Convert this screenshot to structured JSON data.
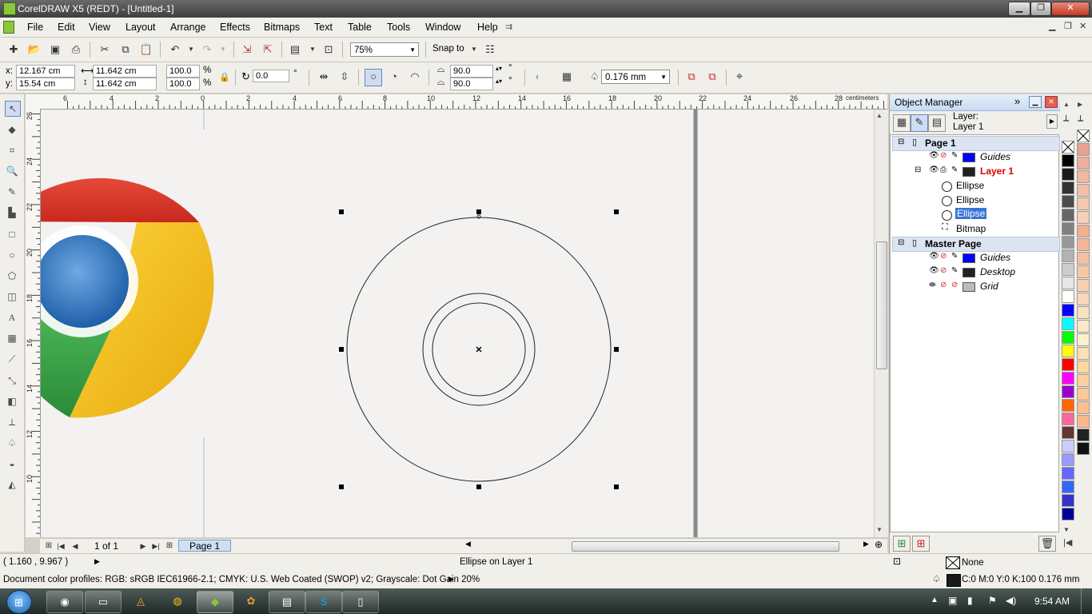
{
  "title": "CorelDRAW X5 (REDT) - [Untitled-1]",
  "window_buttons": {
    "minimize": "▁",
    "restore": "❐",
    "close": "✕"
  },
  "menu": [
    "File",
    "Edit",
    "View",
    "Layout",
    "Arrange",
    "Effects",
    "Bitmaps",
    "Text",
    "Table",
    "Tools",
    "Window",
    "Help"
  ],
  "toolbar": {
    "zoom": "75%",
    "snap_to": "Snap to"
  },
  "propbar": {
    "x": "12.167 cm",
    "y": "15.54 cm",
    "w": "11.642 cm",
    "h": "11.642 cm",
    "scale_x": "100.0",
    "scale_y": "100.0",
    "pct": "%",
    "rotation": "0.0",
    "degree": "°",
    "start_angle": "90.0",
    "end_angle": "90.0",
    "outline": "0.176 mm"
  },
  "ruler": {
    "h_labels": [
      "6",
      "4",
      "2",
      "0",
      "2",
      "4",
      "6",
      "8",
      "10",
      "12",
      "14",
      "16",
      "18",
      "20",
      "22",
      "24",
      "26",
      "28"
    ],
    "unit": "centimeters",
    "v_labels": [
      "26",
      "24",
      "22",
      "20",
      "18",
      "16",
      "14",
      "12",
      "10"
    ]
  },
  "pager": {
    "position": "1 of 1",
    "tab": "Page 1"
  },
  "docker": {
    "title": "Object Manager",
    "layer_label": "Layer:",
    "layer_name": "Layer 1",
    "rows": [
      {
        "kind": "page",
        "label": "Page 1"
      },
      {
        "kind": "layer",
        "label": "Guides",
        "color": "#0000ff"
      },
      {
        "kind": "layer",
        "label": "Layer 1",
        "color": "#222222",
        "active": true
      },
      {
        "kind": "object",
        "label": "Ellipse"
      },
      {
        "kind": "object",
        "label": "Ellipse"
      },
      {
        "kind": "object",
        "label": "Ellipse",
        "selected": true
      },
      {
        "kind": "object",
        "label": "Bitmap"
      },
      {
        "kind": "page",
        "label": "Master Page"
      },
      {
        "kind": "layer",
        "label": "Guides",
        "color": "#0000ff"
      },
      {
        "kind": "layer",
        "label": "Desktop",
        "color": "#222222"
      },
      {
        "kind": "layer",
        "label": "Grid",
        "color": "#bbbbbb"
      }
    ]
  },
  "palette": {
    "col1": [
      "#ffffff",
      "#000000",
      "#1a1a1a",
      "#333333",
      "#4d4d4d",
      "#666666",
      "#808080",
      "#999999",
      "#b3b3b3",
      "#cccccc",
      "#e6e6e6",
      "#ffffff",
      "#0000ff",
      "#00ffff",
      "#00ff00",
      "#ffff00",
      "#ff0000",
      "#ff00ff",
      "#9900cc",
      "#ff6600",
      "#ff6699",
      "#663333",
      "#ccccff",
      "#9999ff",
      "#6666ff",
      "#3366ff",
      "#3333cc",
      "#000099"
    ],
    "col2": [
      "#ffffff",
      "#e8a090",
      "#eeb09a",
      "#f0b8a0",
      "#f2c0a8",
      "#f4c8b0",
      "#f6d0b8",
      "#f0b090",
      "#f2b898",
      "#f4c0a0",
      "#f6c8a8",
      "#f8d0b0",
      "#f8d8b8",
      "#fae0c0",
      "#fce8c8",
      "#fff0d0",
      "#ffe0b0",
      "#ffd8a0",
      "#ffd0a0",
      "#ffc898",
      "#ffc090",
      "#ffb888",
      "#222222",
      "#111111"
    ]
  },
  "status": {
    "coords": "( 1.160 , 9.967 )",
    "selection": "Ellipse on Layer 1",
    "fill": "None",
    "profiles": "Document color profiles: RGB: sRGB IEC61966-2.1; CMYK: U.S. Web Coated (SWOP) v2; Grayscale: Dot Gain 20%",
    "outline": "C:0 M:0 Y:0 K:100  0.176 mm"
  },
  "taskbar": {
    "time": "9:54 AM"
  }
}
